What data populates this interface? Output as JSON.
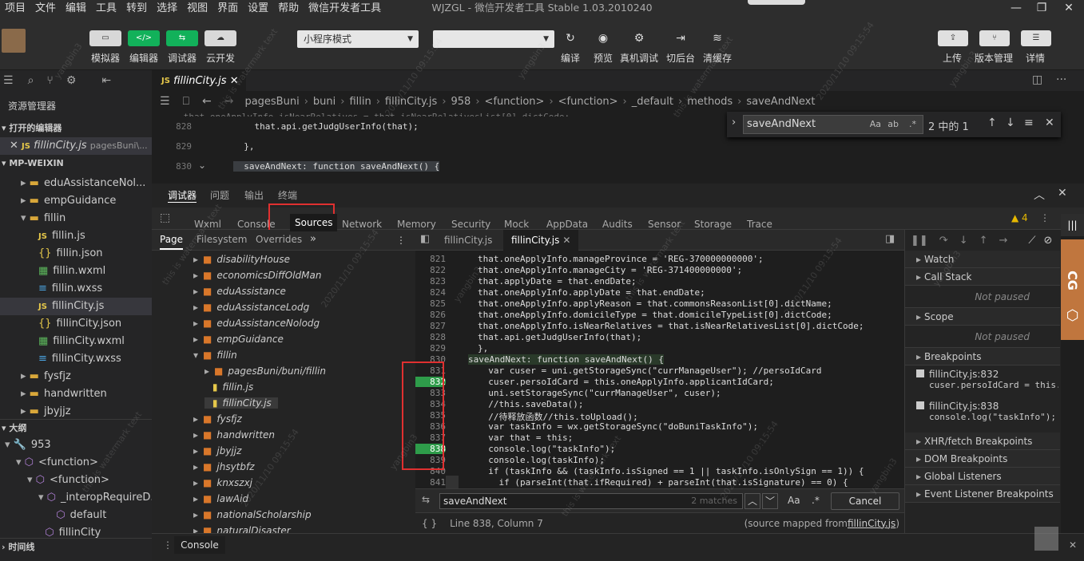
{
  "menubar": {
    "items": [
      "项目",
      "文件",
      "编辑",
      "工具",
      "转到",
      "选择",
      "视图",
      "界面",
      "设置",
      "帮助",
      "微信开发者工具"
    ],
    "title": "WJZGL - 微信开发者工具 Stable 1.03.2010240"
  },
  "toolbar": {
    "left": [
      {
        "label": "模拟器",
        "icon": "▭"
      },
      {
        "label": "编辑器",
        "icon": "</>"
      },
      {
        "label": "调试器",
        "icon": "⇆"
      },
      {
        "label": "云开发",
        "icon": "☁"
      }
    ],
    "mode": "小程序模式",
    "compile_select": "",
    "right": [
      {
        "label": "编译",
        "icon": "↻"
      },
      {
        "label": "预览",
        "icon": "◉"
      },
      {
        "label": "真机调试",
        "icon": "⚙"
      },
      {
        "label": "切后台",
        "icon": "⇥"
      },
      {
        "label": "清缓存",
        "icon": "≋"
      }
    ],
    "far": [
      {
        "label": "上传",
        "icon": "⇪"
      },
      {
        "label": "版本管理",
        "icon": "⑂"
      },
      {
        "label": "详情",
        "icon": "☰"
      }
    ]
  },
  "sidebar": {
    "explorer": "资源管理器",
    "open_editors": "打开的编辑器",
    "open_file": "fillinCity.js",
    "open_file_path": "pagesBuni\\...",
    "project": "MP-WEIXIN",
    "tree": [
      {
        "name": "eduAssistanceNol...",
        "type": "folder",
        "depth": 1
      },
      {
        "name": "empGuidance",
        "type": "folder",
        "depth": 1
      },
      {
        "name": "fillin",
        "type": "folder-open",
        "depth": 1
      },
      {
        "name": "fillin.js",
        "type": "js",
        "depth": 2
      },
      {
        "name": "fillin.json",
        "type": "json",
        "depth": 2
      },
      {
        "name": "fillin.wxml",
        "type": "wxml",
        "depth": 2
      },
      {
        "name": "fillin.wxss",
        "type": "wxss",
        "depth": 2
      },
      {
        "name": "fillinCity.js",
        "type": "js",
        "depth": 2
      },
      {
        "name": "fillinCity.json",
        "type": "json",
        "depth": 2
      },
      {
        "name": "fillinCity.wxml",
        "type": "wxml",
        "depth": 2
      },
      {
        "name": "fillinCity.wxss",
        "type": "wxss",
        "depth": 2
      },
      {
        "name": "fysfjz",
        "type": "folder",
        "depth": 1
      },
      {
        "name": "handwritten",
        "type": "folder",
        "depth": 1
      },
      {
        "name": "jbyjjz",
        "type": "folder",
        "depth": 1
      }
    ],
    "outline": "大纲",
    "outline_items": [
      {
        "name": "953",
        "depth": 0
      },
      {
        "name": "<function>",
        "depth": 1
      },
      {
        "name": "<function>",
        "depth": 2
      },
      {
        "name": "_interopRequireD...",
        "depth": 3
      },
      {
        "name": "default",
        "depth": 4
      },
      {
        "name": "fillinCity",
        "depth": 3
      }
    ],
    "timeline": "时间线"
  },
  "editor": {
    "tab": "fillinCity.js",
    "breadcrumb": [
      "pagesBuni",
      "buni",
      "fillin",
      "fillinCity.js",
      "958",
      "<function>",
      "<function>",
      "_default",
      "methods",
      "saveAndNext"
    ],
    "lines": [
      {
        "n": "828",
        "t": "    that.api.getJudgUserInfo(that);"
      },
      {
        "n": "829",
        "t": "  },"
      },
      {
        "n": "830",
        "t": "  saveAndNext: function saveAndNext() {"
      }
    ],
    "find": {
      "value": "saveAndNext",
      "result": "2 中的 1"
    }
  },
  "devtools": {
    "top_tabs": [
      "调试器",
      "问题",
      "输出",
      "终端"
    ],
    "tabs": [
      "Wxml",
      "Console",
      "Sources",
      "Network",
      "Memory",
      "Security",
      "Mock",
      "AppData",
      "Audits",
      "Sensor",
      "Storage",
      "Trace"
    ],
    "warnings": "4",
    "nav_tabs": [
      "Page",
      "Filesystem",
      "Overrides"
    ],
    "tree": [
      {
        "name": "disabilityHouse",
        "type": "folder",
        "depth": 0
      },
      {
        "name": "economicsDiffOldMan",
        "type": "folder",
        "depth": 0
      },
      {
        "name": "eduAssistance",
        "type": "folder",
        "depth": 0
      },
      {
        "name": "eduAssistanceLodg",
        "type": "folder",
        "depth": 0
      },
      {
        "name": "eduAssistanceNolodg",
        "type": "folder",
        "depth": 0
      },
      {
        "name": "empGuidance",
        "type": "folder",
        "depth": 0
      },
      {
        "name": "fillin",
        "type": "folder-open",
        "depth": 0
      },
      {
        "name": "pagesBuni/buni/fillin",
        "type": "folder",
        "depth": 1
      },
      {
        "name": "fillin.js",
        "type": "file",
        "depth": 1
      },
      {
        "name": "fillinCity.js",
        "type": "file",
        "depth": 1
      },
      {
        "name": "fysfjz",
        "type": "folder",
        "depth": 0
      },
      {
        "name": "handwritten",
        "type": "folder",
        "depth": 0
      },
      {
        "name": "jbyjjz",
        "type": "folder",
        "depth": 0
      },
      {
        "name": "jhsytbfz",
        "type": "folder",
        "depth": 0
      },
      {
        "name": "knxszxj",
        "type": "folder",
        "depth": 0
      },
      {
        "name": "lawAid",
        "type": "folder",
        "depth": 0
      },
      {
        "name": "nationalScholarship",
        "type": "folder",
        "depth": 0
      },
      {
        "name": "naturalDisaster",
        "type": "folder",
        "depth": 0
      }
    ],
    "file_tabs": [
      "fillinCity.js",
      "fillinCity.js"
    ],
    "code": [
      {
        "n": "821",
        "t": "that.oneApplyInfo.manageProvince = 'REG-370000000000';"
      },
      {
        "n": "822",
        "t": "that.oneApplyInfo.manageCity = 'REG-371400000000';"
      },
      {
        "n": "823",
        "t": "that.applyDate = that.endDate;"
      },
      {
        "n": "824",
        "t": "that.oneApplyInfo.applyDate = that.endDate;"
      },
      {
        "n": "825",
        "t": "that.oneApplyInfo.applyReason = that.commonsReasonList[0].dictName;"
      },
      {
        "n": "826",
        "t": "that.oneApplyInfo.domicileType = that.domicileTypeList[0].dictCode;"
      },
      {
        "n": "827",
        "t": "that.oneApplyInfo.isNearRelatives = that.isNearRelativesList[0].dictCode;"
      },
      {
        "n": "828",
        "t": "that.api.getJudgUserInfo(that);"
      },
      {
        "n": "829",
        "t": "},"
      },
      {
        "n": "830",
        "t": "saveAndNext: function saveAndNext() {"
      },
      {
        "n": "831",
        "t": "  var cuser = uni.getStorageSync(\"currManageUser\"); //persoIdCard"
      },
      {
        "n": "832",
        "t": "  cuser.persoIdCard = this.oneApplyInfo.applicantIdCard;"
      },
      {
        "n": "833",
        "t": "  uni.setStorageSync(\"currManageUser\", cuser);"
      },
      {
        "n": "834",
        "t": "  //this.saveData();"
      },
      {
        "n": "835",
        "t": "  //待释放函数//this.toUpload();"
      },
      {
        "n": "836",
        "t": "  var taskInfo = wx.getStorageSync(\"doBuniTaskInfo\");"
      },
      {
        "n": "837",
        "t": "  var that = this;"
      },
      {
        "n": "838",
        "t": "  console.log(\"taskInfo\");"
      },
      {
        "n": "839",
        "t": "  console.log(taskInfo);"
      },
      {
        "n": "840",
        "t": "  if (taskInfo && (taskInfo.isSigned == 1 || taskInfo.isOnlySign == 1)) {"
      },
      {
        "n": "841",
        "t": "    if (parseInt(that.ifRequired) + parseInt(that.isSignature) == 0) {"
      }
    ],
    "search": {
      "value": "saveAndNext",
      "matches": "2 matches",
      "case": "Aa",
      "regex": ".*",
      "cancel": "Cancel"
    },
    "status": {
      "pos": "Line 838, Column 7",
      "mapped": "(source mapped from ",
      "mapped_file": "fillinCity.js",
      "close": ")"
    },
    "right": {
      "watch": "Watch",
      "callstack": "Call Stack",
      "not_paused": "Not paused",
      "scope": "Scope",
      "breakpoints": "Breakpoints",
      "bps": [
        {
          "file": "fillinCity.js:832",
          "code": "cuser.persoIdCard = this.on..."
        },
        {
          "file": "fillinCity.js:838",
          "code": "console.log(\"taskInfo\");"
        }
      ],
      "sections": [
        "XHR/fetch Breakpoints",
        "DOM Breakpoints",
        "Global Listeners",
        "Event Listener Breakpoints"
      ]
    },
    "console_tab": "Console"
  },
  "side_tab": "CG",
  "watermark": [
    "yangbin3",
    "this is watermark text",
    "2020/11/10 09:15:54"
  ],
  "colors": {
    "accent": "#12b15a",
    "highlight": "#e03030",
    "active_tab": "#2a2a2a"
  }
}
